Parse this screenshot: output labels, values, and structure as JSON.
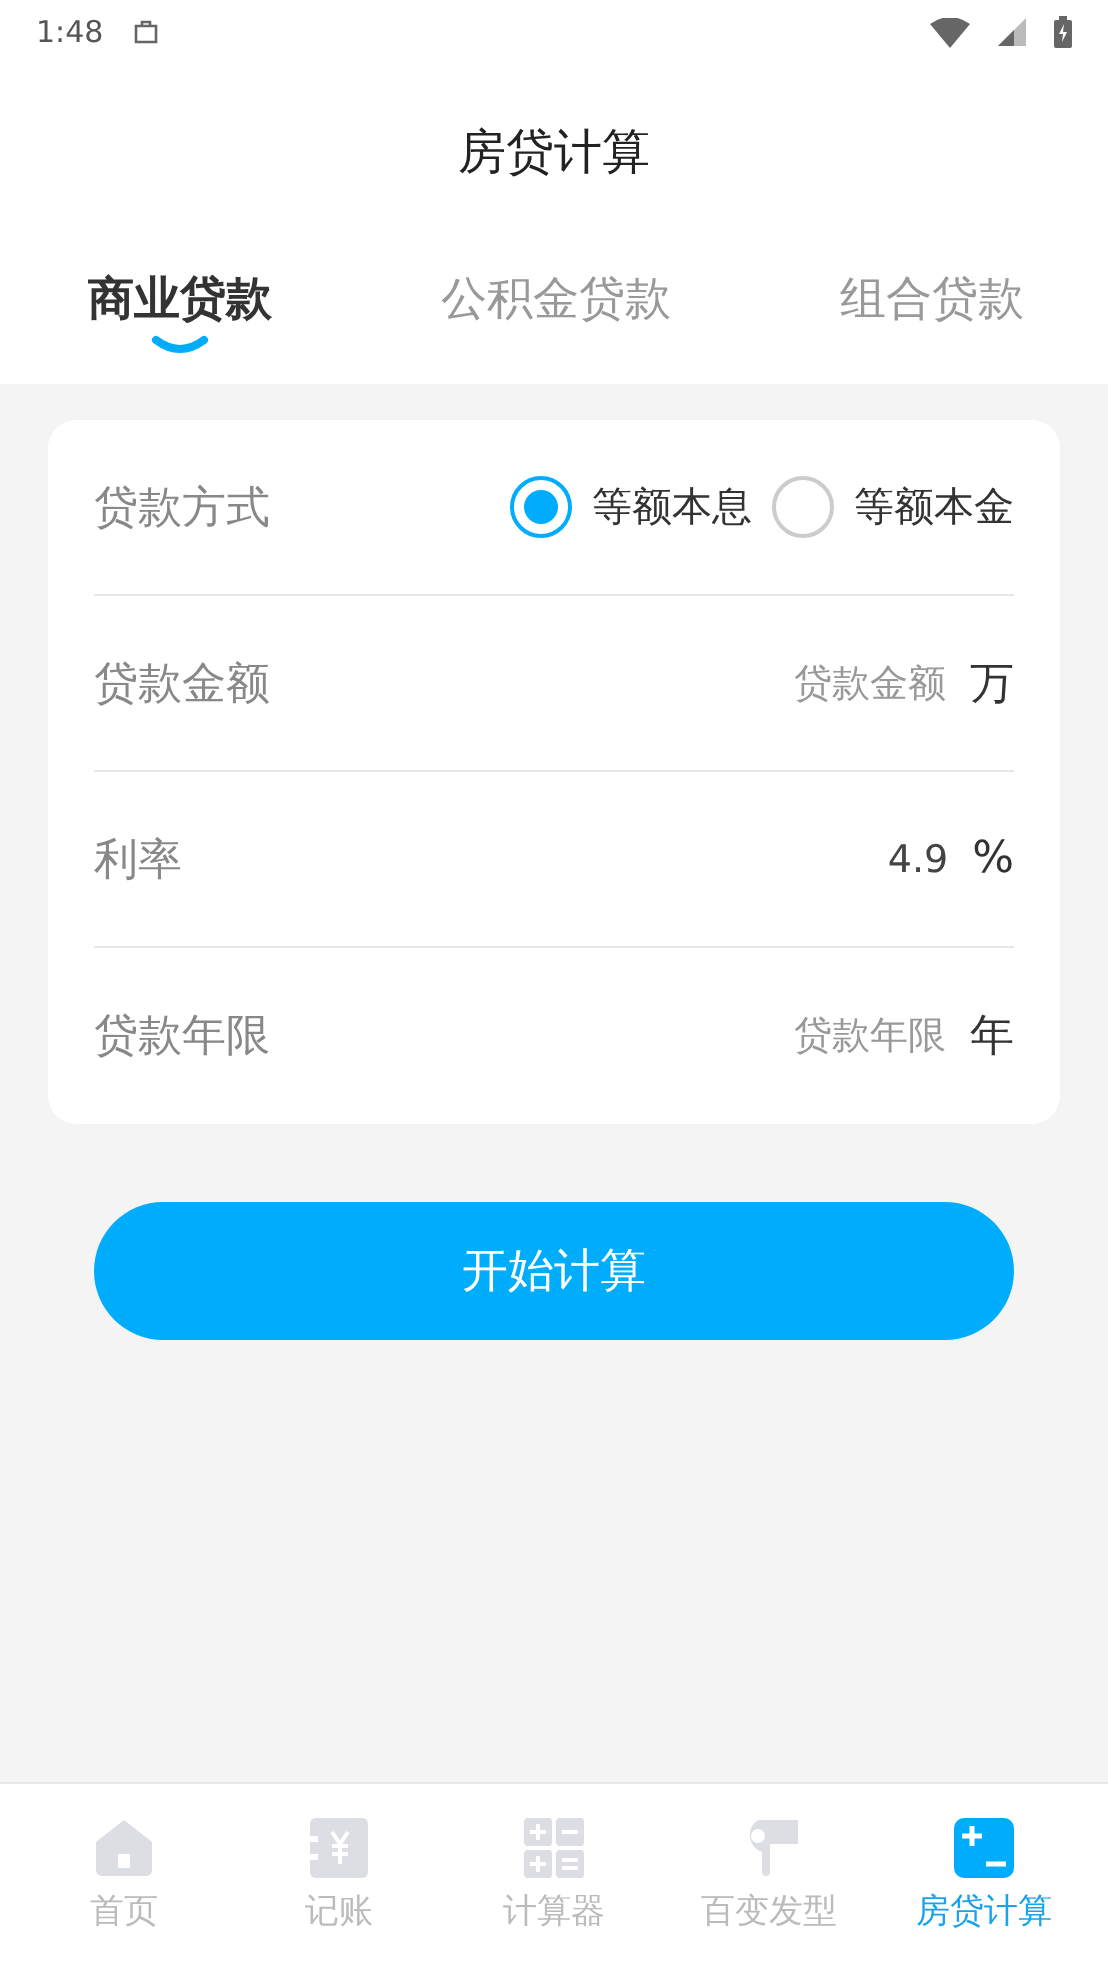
{
  "status_bar": {
    "time": "1:48"
  },
  "title": "房贷计算",
  "tabs": [
    {
      "label": "商业贷款",
      "selected": true
    },
    {
      "label": "公积金贷款",
      "selected": false
    },
    {
      "label": "组合贷款",
      "selected": false
    }
  ],
  "form": [
    {
      "kind": "radio",
      "label": "贷款方式",
      "options": [
        {
          "label": "等额本息",
          "selected": true
        },
        {
          "label": "等额本金",
          "selected": false
        }
      ]
    },
    {
      "kind": "input",
      "label": "贷款金额",
      "placeholder": "贷款金额",
      "unit": "万"
    },
    {
      "kind": "input",
      "label": "利率",
      "value": "4.9",
      "unit": "%"
    },
    {
      "kind": "input",
      "label": "贷款年限",
      "placeholder": "贷款年限",
      "unit": "年"
    }
  ],
  "button": "开始计算",
  "nav": [
    {
      "label": "首页",
      "selected": false
    },
    {
      "label": "记账",
      "selected": false
    },
    {
      "label": "计算器",
      "selected": false
    },
    {
      "label": "百变发型",
      "selected": false
    },
    {
      "label": "房贷计算",
      "selected": true
    }
  ]
}
